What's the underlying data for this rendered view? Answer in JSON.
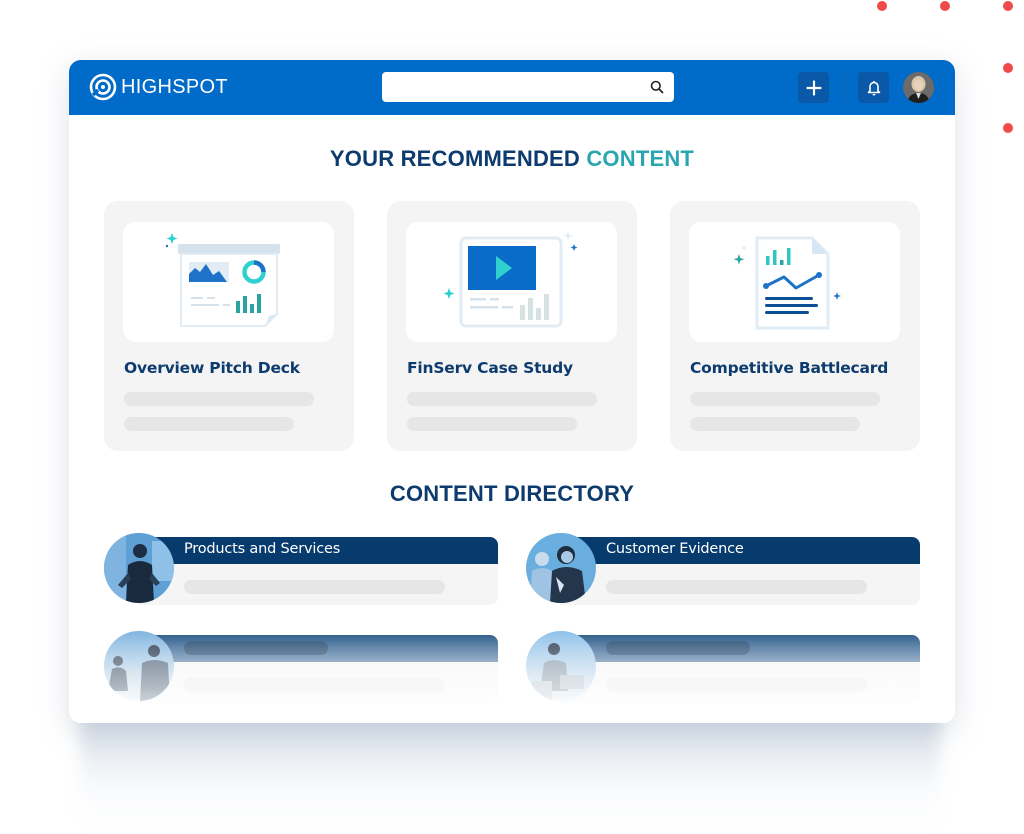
{
  "app": {
    "brand_name": "HIGHSPOT",
    "brand_color": "#006bc8",
    "accent_color": "#2ba6b0",
    "heading_color": "#0d3b6e",
    "decor_dot_color": "#f04a4a"
  },
  "topbar": {
    "search": {
      "value": "",
      "placeholder": "",
      "icon": "search-icon"
    },
    "add_button": {
      "icon": "plus-icon",
      "label": "+"
    },
    "notifications_button": {
      "icon": "bell-icon"
    },
    "avatar": {
      "icon": "user-avatar"
    }
  },
  "recommended": {
    "heading_main": "YOUR RECOMMENDED",
    "heading_accent": "CONTENT",
    "cards": [
      {
        "title": "Overview Pitch Deck",
        "icon": "presentation-icon"
      },
      {
        "title": "FinServ Case Study",
        "icon": "video-play-icon"
      },
      {
        "title": "Competitive Battlecard",
        "icon": "document-chart-icon"
      }
    ]
  },
  "directory": {
    "heading": "CONTENT DIRECTORY",
    "items": [
      {
        "title": "Products and Services",
        "photo": "presenter-photo"
      },
      {
        "title": "Customer Evidence",
        "photo": "customers-photo"
      },
      {
        "title": "",
        "photo": "meeting-photo"
      },
      {
        "title": "",
        "photo": "phone-call-photo"
      }
    ]
  }
}
